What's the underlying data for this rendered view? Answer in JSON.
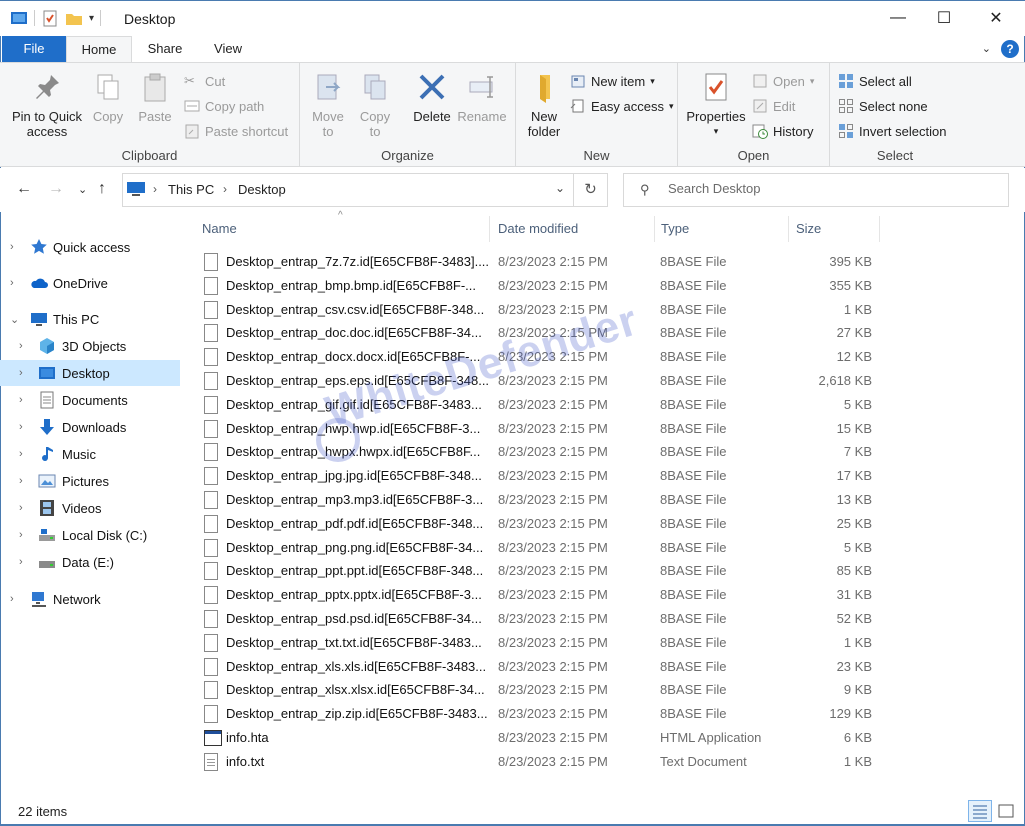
{
  "window": {
    "title": "Desktop",
    "minimize": "—",
    "maximize": "☐",
    "close": "✕"
  },
  "ribbon_tabs": {
    "file": "File",
    "home": "Home",
    "share": "Share",
    "view": "View",
    "help": "?"
  },
  "clipboard": {
    "pin": "Pin to Quick access",
    "copy": "Copy",
    "paste": "Paste",
    "cut": "Cut",
    "copy_path": "Copy path",
    "paste_shortcut": "Paste shortcut",
    "label": "Clipboard"
  },
  "organize": {
    "move_to": "Move to",
    "copy_to": "Copy to",
    "delete": "Delete",
    "rename": "Rename",
    "label": "Organize"
  },
  "new_group": {
    "new_folder": "New folder",
    "new_item": "New item",
    "easy_access": "Easy access",
    "label": "New"
  },
  "open_group": {
    "properties": "Properties",
    "open": "Open",
    "edit": "Edit",
    "history": "History",
    "label": "Open"
  },
  "select_group": {
    "select_all": "Select all",
    "select_none": "Select none",
    "invert": "Invert selection",
    "label": "Select"
  },
  "address": {
    "crumbs": [
      "This PC",
      "Desktop"
    ],
    "search_placeholder": "Search Desktop"
  },
  "nav": {
    "quick_access": "Quick access",
    "onedrive": "OneDrive",
    "this_pc": "This PC",
    "objects3d": "3D Objects",
    "desktop": "Desktop",
    "documents": "Documents",
    "downloads": "Downloads",
    "music": "Music",
    "pictures": "Pictures",
    "videos": "Videos",
    "local_disk": "Local Disk (C:)",
    "data_e": "Data (E:)",
    "network": "Network"
  },
  "columns": {
    "name": "Name",
    "date": "Date modified",
    "type": "Type",
    "size": "Size"
  },
  "files": [
    {
      "name": "Desktop_entrap_7z.7z.id[E65CFB8F-3483]....",
      "date": "8/23/2023 2:15 PM",
      "type": "8BASE File",
      "size": "395 KB",
      "icon": "blank"
    },
    {
      "name": "Desktop_entrap_bmp.bmp.id[E65CFB8F-...",
      "date": "8/23/2023 2:15 PM",
      "type": "8BASE File",
      "size": "355 KB",
      "icon": "blank"
    },
    {
      "name": "Desktop_entrap_csv.csv.id[E65CFB8F-348...",
      "date": "8/23/2023 2:15 PM",
      "type": "8BASE File",
      "size": "1 KB",
      "icon": "blank"
    },
    {
      "name": "Desktop_entrap_doc.doc.id[E65CFB8F-34...",
      "date": "8/23/2023 2:15 PM",
      "type": "8BASE File",
      "size": "27 KB",
      "icon": "blank"
    },
    {
      "name": "Desktop_entrap_docx.docx.id[E65CFB8F-...",
      "date": "8/23/2023 2:15 PM",
      "type": "8BASE File",
      "size": "12 KB",
      "icon": "blank"
    },
    {
      "name": "Desktop_entrap_eps.eps.id[E65CFB8F-348...",
      "date": "8/23/2023 2:15 PM",
      "type": "8BASE File",
      "size": "2,618 KB",
      "icon": "blank"
    },
    {
      "name": "Desktop_entrap_gif.gif.id[E65CFB8F-3483...",
      "date": "8/23/2023 2:15 PM",
      "type": "8BASE File",
      "size": "5 KB",
      "icon": "blank"
    },
    {
      "name": "Desktop_entrap_hwp.hwp.id[E65CFB8F-3...",
      "date": "8/23/2023 2:15 PM",
      "type": "8BASE File",
      "size": "15 KB",
      "icon": "blank"
    },
    {
      "name": "Desktop_entrap_hwpx.hwpx.id[E65CFB8F...",
      "date": "8/23/2023 2:15 PM",
      "type": "8BASE File",
      "size": "7 KB",
      "icon": "blank"
    },
    {
      "name": "Desktop_entrap_jpg.jpg.id[E65CFB8F-348...",
      "date": "8/23/2023 2:15 PM",
      "type": "8BASE File",
      "size": "17 KB",
      "icon": "blank"
    },
    {
      "name": "Desktop_entrap_mp3.mp3.id[E65CFB8F-3...",
      "date": "8/23/2023 2:15 PM",
      "type": "8BASE File",
      "size": "13 KB",
      "icon": "blank"
    },
    {
      "name": "Desktop_entrap_pdf.pdf.id[E65CFB8F-348...",
      "date": "8/23/2023 2:15 PM",
      "type": "8BASE File",
      "size": "25 KB",
      "icon": "blank"
    },
    {
      "name": "Desktop_entrap_png.png.id[E65CFB8F-34...",
      "date": "8/23/2023 2:15 PM",
      "type": "8BASE File",
      "size": "5 KB",
      "icon": "blank"
    },
    {
      "name": "Desktop_entrap_ppt.ppt.id[E65CFB8F-348...",
      "date": "8/23/2023 2:15 PM",
      "type": "8BASE File",
      "size": "85 KB",
      "icon": "blank"
    },
    {
      "name": "Desktop_entrap_pptx.pptx.id[E65CFB8F-3...",
      "date": "8/23/2023 2:15 PM",
      "type": "8BASE File",
      "size": "31 KB",
      "icon": "blank"
    },
    {
      "name": "Desktop_entrap_psd.psd.id[E65CFB8F-34...",
      "date": "8/23/2023 2:15 PM",
      "type": "8BASE File",
      "size": "52 KB",
      "icon": "blank"
    },
    {
      "name": "Desktop_entrap_txt.txt.id[E65CFB8F-3483...",
      "date": "8/23/2023 2:15 PM",
      "type": "8BASE File",
      "size": "1 KB",
      "icon": "blank"
    },
    {
      "name": "Desktop_entrap_xls.xls.id[E65CFB8F-3483...",
      "date": "8/23/2023 2:15 PM",
      "type": "8BASE File",
      "size": "23 KB",
      "icon": "blank"
    },
    {
      "name": "Desktop_entrap_xlsx.xlsx.id[E65CFB8F-34...",
      "date": "8/23/2023 2:15 PM",
      "type": "8BASE File",
      "size": "9 KB",
      "icon": "blank"
    },
    {
      "name": "Desktop_entrap_zip.zip.id[E65CFB8F-3483...",
      "date": "8/23/2023 2:15 PM",
      "type": "8BASE File",
      "size": "129 KB",
      "icon": "blank"
    },
    {
      "name": "info.hta",
      "date": "8/23/2023 2:15 PM",
      "type": "HTML Application",
      "size": "6 KB",
      "icon": "hta"
    },
    {
      "name": "info.txt",
      "date": "8/23/2023 2:15 PM",
      "type": "Text Document",
      "size": "1 KB",
      "icon": "txt"
    }
  ],
  "status": {
    "item_count": "22 items"
  },
  "watermark": "WhiteDefender",
  "colors": {
    "accent": "#1f6ec9",
    "selection": "#cce8ff",
    "folder": "#f3c44f"
  }
}
